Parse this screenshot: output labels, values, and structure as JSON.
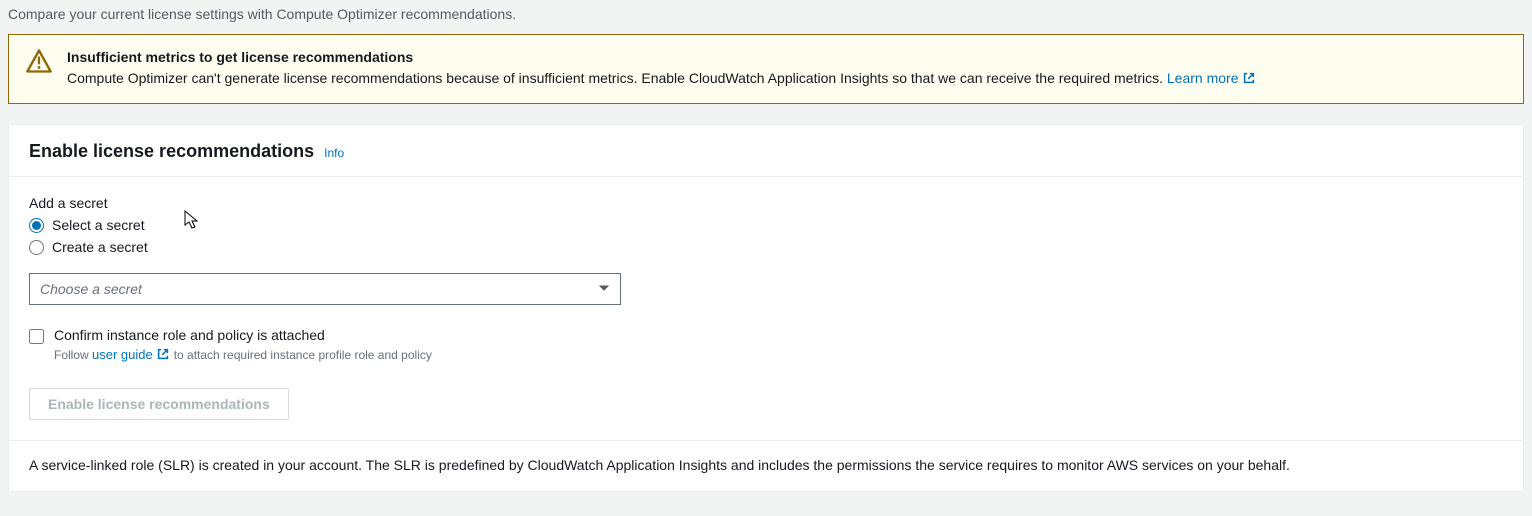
{
  "page": {
    "description": "Compare your current license settings with Compute Optimizer recommendations."
  },
  "alert": {
    "title": "Insufficient metrics to get license recommendations",
    "text": "Compute Optimizer can't generate license recommendations because of insufficient metrics. Enable CloudWatch Application Insights so that we can receive the required metrics. ",
    "learn_more": "Learn more"
  },
  "panel": {
    "title": "Enable license recommendations",
    "info": "Info"
  },
  "secret": {
    "group_label": "Add a secret",
    "option_select": "Select a secret",
    "option_create": "Create a secret",
    "dropdown_placeholder": "Choose a secret"
  },
  "confirm": {
    "label": "Confirm instance role and policy is attached",
    "help_prefix": "Follow ",
    "user_guide": "user guide",
    "help_suffix": " to attach required instance profile role and policy"
  },
  "button": {
    "enable": "Enable license recommendations"
  },
  "footnote": {
    "text": "A service-linked role (SLR) is created in your account. The SLR is predefined by CloudWatch Application Insights and includes the permissions the service requires to monitor AWS services on your behalf."
  }
}
